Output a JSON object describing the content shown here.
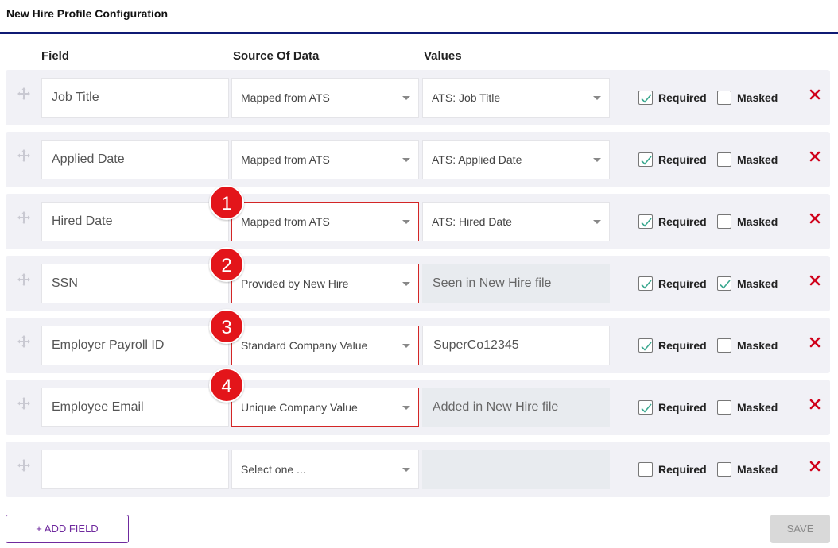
{
  "header": {
    "title": "New Hire Profile Configuration"
  },
  "columns": {
    "field": "Field",
    "source": "Source Of Data",
    "values": "Values"
  },
  "checkbox_labels": {
    "required": "Required",
    "masked": "Masked"
  },
  "rows": [
    {
      "field": "Job Title",
      "source": "Mapped from ATS",
      "value": "ATS: Job Title",
      "value_mode": "select",
      "required": true,
      "masked": false
    },
    {
      "field": "Applied Date",
      "source": "Mapped from ATS",
      "value": "ATS: Applied Date",
      "value_mode": "select",
      "required": true,
      "masked": false
    },
    {
      "field": "Hired Date",
      "source": "Mapped from ATS",
      "value": "ATS: Hired Date",
      "value_mode": "select",
      "required": true,
      "masked": false
    },
    {
      "field": "SSN",
      "source": "Provided by New Hire",
      "value": "Seen in New Hire file",
      "value_mode": "static",
      "required": true,
      "masked": true
    },
    {
      "field": "Employer Payroll ID",
      "source": "Standard Company Value",
      "value": "SuperCo12345",
      "value_mode": "text",
      "required": true,
      "masked": false
    },
    {
      "field": "Employee Email",
      "source": "Unique Company Value",
      "value": "Added in New Hire file",
      "value_mode": "static",
      "required": true,
      "masked": false
    },
    {
      "field": "",
      "source": "Select one ...",
      "value": "",
      "value_mode": "static",
      "required": false,
      "masked": false
    }
  ],
  "annotations": [
    "1",
    "2",
    "3",
    "4"
  ],
  "buttons": {
    "add_field": "+ ADD FIELD",
    "save": "SAVE"
  },
  "colors": {
    "accent": "#6f2a9e",
    "header_rule": "#0f1a74",
    "delete": "#d0021b",
    "highlight": "#d32626",
    "badge": "#e3151a",
    "check": "#3aa88f"
  },
  "icons": {
    "drag": "drag-handle-icon",
    "delete": "close-icon",
    "check": "checkmark-icon",
    "caret": "chevron-down-icon"
  }
}
